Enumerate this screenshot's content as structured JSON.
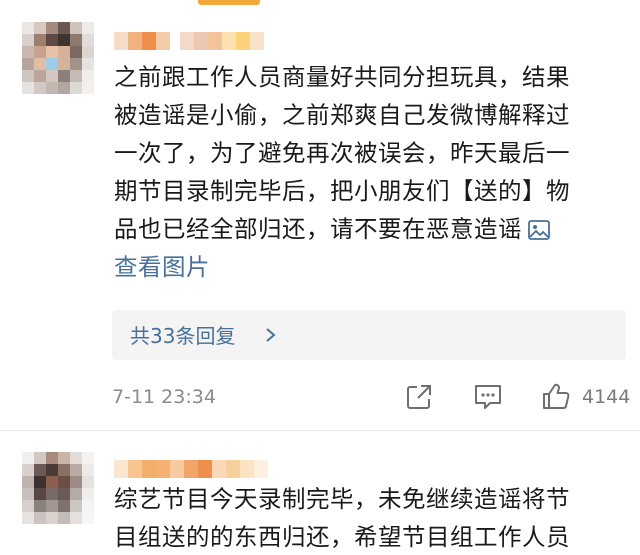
{
  "comments": [
    {
      "text_lines": [
        "之前跟工作人员商量好共同分担玩具，结果",
        "被造谣是小偷，之前郑爽自己发微博解释过",
        "一次了，为了避免再次被误会，昨天最后一",
        "期节目录制完毕后，把小朋友们【送的】物",
        "品也已经全部归还，请不要在恶意造谣"
      ],
      "view_image_label": "查看图片",
      "replies_label": "共33条回复",
      "timestamp": "7-11 23:34",
      "like_count": "4144"
    },
    {
      "text_lines": [
        "综艺节目今天录制完毕，未免继续造谣将节",
        "目组送的的东西归还，希望节目组工作人员"
      ]
    }
  ],
  "icons": {
    "image": "image-icon",
    "chevron": "chevron-right-icon",
    "share": "share-icon",
    "reply": "comment-icon",
    "like": "thumbs-up-icon"
  },
  "colors": {
    "text": "#1a1a1a",
    "link": "#48709a",
    "meta": "#8a8a8a",
    "reply_bg": "#f4f4f4",
    "accent": "#f3a73a"
  }
}
